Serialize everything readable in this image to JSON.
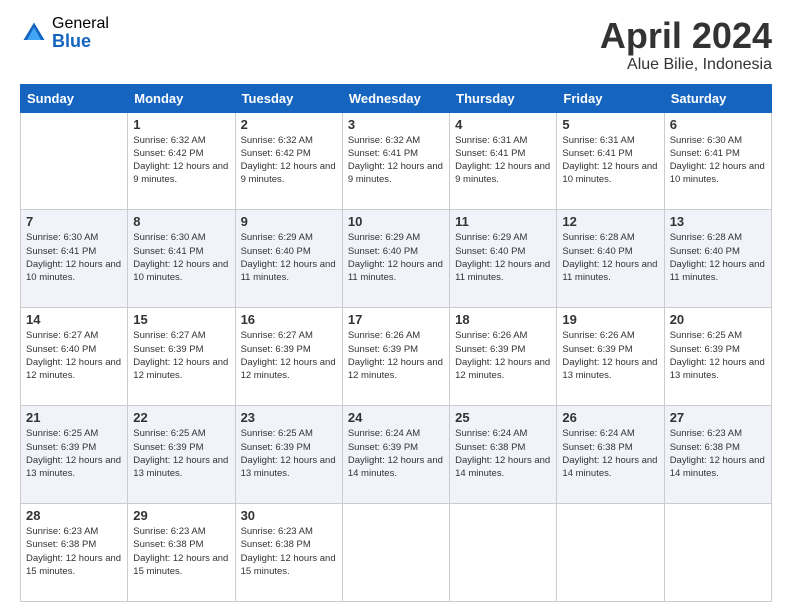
{
  "logo": {
    "general": "General",
    "blue": "Blue"
  },
  "title": "April 2024",
  "location": "Alue Bilie, Indonesia",
  "days_of_week": [
    "Sunday",
    "Monday",
    "Tuesday",
    "Wednesday",
    "Thursday",
    "Friday",
    "Saturday"
  ],
  "weeks": [
    [
      {
        "day": "",
        "sunrise": "",
        "sunset": "",
        "daylight": "",
        "empty": true
      },
      {
        "day": "1",
        "sunrise": "Sunrise: 6:32 AM",
        "sunset": "Sunset: 6:42 PM",
        "daylight": "Daylight: 12 hours and 9 minutes."
      },
      {
        "day": "2",
        "sunrise": "Sunrise: 6:32 AM",
        "sunset": "Sunset: 6:42 PM",
        "daylight": "Daylight: 12 hours and 9 minutes."
      },
      {
        "day": "3",
        "sunrise": "Sunrise: 6:32 AM",
        "sunset": "Sunset: 6:41 PM",
        "daylight": "Daylight: 12 hours and 9 minutes."
      },
      {
        "day": "4",
        "sunrise": "Sunrise: 6:31 AM",
        "sunset": "Sunset: 6:41 PM",
        "daylight": "Daylight: 12 hours and 9 minutes."
      },
      {
        "day": "5",
        "sunrise": "Sunrise: 6:31 AM",
        "sunset": "Sunset: 6:41 PM",
        "daylight": "Daylight: 12 hours and 10 minutes."
      },
      {
        "day": "6",
        "sunrise": "Sunrise: 6:30 AM",
        "sunset": "Sunset: 6:41 PM",
        "daylight": "Daylight: 12 hours and 10 minutes."
      }
    ],
    [
      {
        "day": "7",
        "sunrise": "Sunrise: 6:30 AM",
        "sunset": "Sunset: 6:41 PM",
        "daylight": "Daylight: 12 hours and 10 minutes."
      },
      {
        "day": "8",
        "sunrise": "Sunrise: 6:30 AM",
        "sunset": "Sunset: 6:41 PM",
        "daylight": "Daylight: 12 hours and 10 minutes."
      },
      {
        "day": "9",
        "sunrise": "Sunrise: 6:29 AM",
        "sunset": "Sunset: 6:40 PM",
        "daylight": "Daylight: 12 hours and 11 minutes."
      },
      {
        "day": "10",
        "sunrise": "Sunrise: 6:29 AM",
        "sunset": "Sunset: 6:40 PM",
        "daylight": "Daylight: 12 hours and 11 minutes."
      },
      {
        "day": "11",
        "sunrise": "Sunrise: 6:29 AM",
        "sunset": "Sunset: 6:40 PM",
        "daylight": "Daylight: 12 hours and 11 minutes."
      },
      {
        "day": "12",
        "sunrise": "Sunrise: 6:28 AM",
        "sunset": "Sunset: 6:40 PM",
        "daylight": "Daylight: 12 hours and 11 minutes."
      },
      {
        "day": "13",
        "sunrise": "Sunrise: 6:28 AM",
        "sunset": "Sunset: 6:40 PM",
        "daylight": "Daylight: 12 hours and 11 minutes."
      }
    ],
    [
      {
        "day": "14",
        "sunrise": "Sunrise: 6:27 AM",
        "sunset": "Sunset: 6:40 PM",
        "daylight": "Daylight: 12 hours and 12 minutes."
      },
      {
        "day": "15",
        "sunrise": "Sunrise: 6:27 AM",
        "sunset": "Sunset: 6:39 PM",
        "daylight": "Daylight: 12 hours and 12 minutes."
      },
      {
        "day": "16",
        "sunrise": "Sunrise: 6:27 AM",
        "sunset": "Sunset: 6:39 PM",
        "daylight": "Daylight: 12 hours and 12 minutes."
      },
      {
        "day": "17",
        "sunrise": "Sunrise: 6:26 AM",
        "sunset": "Sunset: 6:39 PM",
        "daylight": "Daylight: 12 hours and 12 minutes."
      },
      {
        "day": "18",
        "sunrise": "Sunrise: 6:26 AM",
        "sunset": "Sunset: 6:39 PM",
        "daylight": "Daylight: 12 hours and 12 minutes."
      },
      {
        "day": "19",
        "sunrise": "Sunrise: 6:26 AM",
        "sunset": "Sunset: 6:39 PM",
        "daylight": "Daylight: 12 hours and 13 minutes."
      },
      {
        "day": "20",
        "sunrise": "Sunrise: 6:25 AM",
        "sunset": "Sunset: 6:39 PM",
        "daylight": "Daylight: 12 hours and 13 minutes."
      }
    ],
    [
      {
        "day": "21",
        "sunrise": "Sunrise: 6:25 AM",
        "sunset": "Sunset: 6:39 PM",
        "daylight": "Daylight: 12 hours and 13 minutes."
      },
      {
        "day": "22",
        "sunrise": "Sunrise: 6:25 AM",
        "sunset": "Sunset: 6:39 PM",
        "daylight": "Daylight: 12 hours and 13 minutes."
      },
      {
        "day": "23",
        "sunrise": "Sunrise: 6:25 AM",
        "sunset": "Sunset: 6:39 PM",
        "daylight": "Daylight: 12 hours and 13 minutes."
      },
      {
        "day": "24",
        "sunrise": "Sunrise: 6:24 AM",
        "sunset": "Sunset: 6:39 PM",
        "daylight": "Daylight: 12 hours and 14 minutes."
      },
      {
        "day": "25",
        "sunrise": "Sunrise: 6:24 AM",
        "sunset": "Sunset: 6:38 PM",
        "daylight": "Daylight: 12 hours and 14 minutes."
      },
      {
        "day": "26",
        "sunrise": "Sunrise: 6:24 AM",
        "sunset": "Sunset: 6:38 PM",
        "daylight": "Daylight: 12 hours and 14 minutes."
      },
      {
        "day": "27",
        "sunrise": "Sunrise: 6:23 AM",
        "sunset": "Sunset: 6:38 PM",
        "daylight": "Daylight: 12 hours and 14 minutes."
      }
    ],
    [
      {
        "day": "28",
        "sunrise": "Sunrise: 6:23 AM",
        "sunset": "Sunset: 6:38 PM",
        "daylight": "Daylight: 12 hours and 15 minutes."
      },
      {
        "day": "29",
        "sunrise": "Sunrise: 6:23 AM",
        "sunset": "Sunset: 6:38 PM",
        "daylight": "Daylight: 12 hours and 15 minutes."
      },
      {
        "day": "30",
        "sunrise": "Sunrise: 6:23 AM",
        "sunset": "Sunset: 6:38 PM",
        "daylight": "Daylight: 12 hours and 15 minutes."
      },
      {
        "day": "",
        "sunrise": "",
        "sunset": "",
        "daylight": "",
        "empty": true
      },
      {
        "day": "",
        "sunrise": "",
        "sunset": "",
        "daylight": "",
        "empty": true
      },
      {
        "day": "",
        "sunrise": "",
        "sunset": "",
        "daylight": "",
        "empty": true
      },
      {
        "day": "",
        "sunrise": "",
        "sunset": "",
        "daylight": "",
        "empty": true
      }
    ]
  ]
}
